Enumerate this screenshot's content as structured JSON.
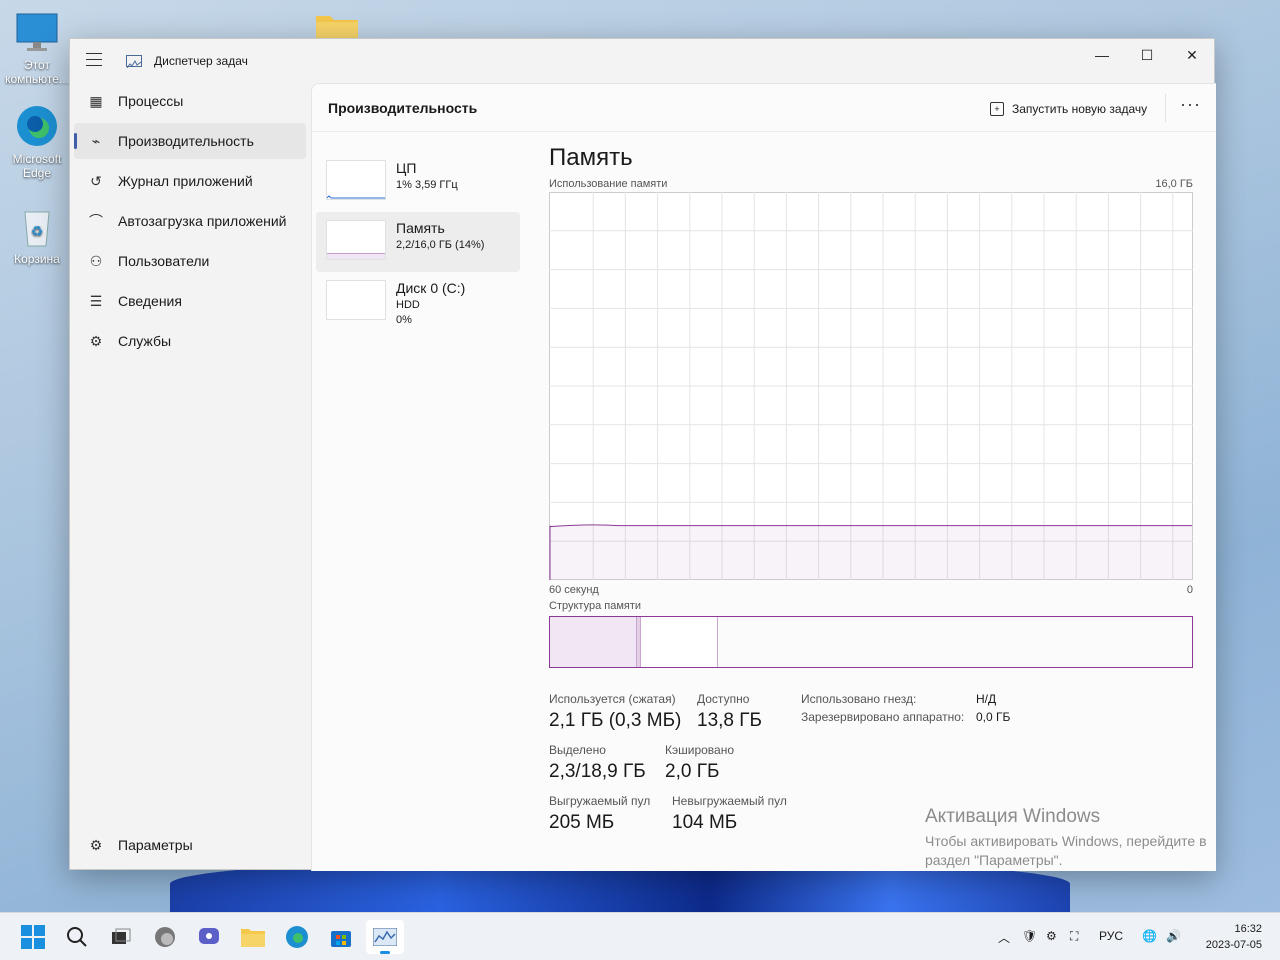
{
  "desktop": {
    "icons": [
      {
        "label": "Этот компьюте..."
      },
      {
        "label": "Microsoft Edge"
      },
      {
        "label": "Корзина"
      }
    ]
  },
  "window": {
    "title": "Диспетчер задач",
    "controls": {
      "minimize": "—",
      "maximize": "☐",
      "close": "✕"
    }
  },
  "nav": {
    "items": [
      {
        "label": "Процессы",
        "icon": "processes-icon"
      },
      {
        "label": "Производительность",
        "icon": "performance-icon",
        "active": true
      },
      {
        "label": "Журнал приложений",
        "icon": "history-icon"
      },
      {
        "label": "Автозагрузка приложений",
        "icon": "startup-icon"
      },
      {
        "label": "Пользователи",
        "icon": "users-icon"
      },
      {
        "label": "Сведения",
        "icon": "details-icon"
      },
      {
        "label": "Службы",
        "icon": "services-icon"
      }
    ],
    "settings_label": "Параметры"
  },
  "header": {
    "title": "Производительность",
    "run_task": "Запустить новую задачу",
    "more": "···"
  },
  "perf_list": [
    {
      "name": "ЦП",
      "sub1": "1% 3,59 ГГц",
      "sub2": ""
    },
    {
      "name": "Память",
      "sub1": "2,2/16,0 ГБ (14%)",
      "sub2": "",
      "selected": true
    },
    {
      "name": "Диск 0 (C:)",
      "sub1": "HDD",
      "sub2": "0%"
    }
  ],
  "memory": {
    "title": "Память",
    "usage_label": "Использование памяти",
    "max_label": "16,0 ГБ",
    "time_left": "60 секунд",
    "time_right": "0",
    "usage_fraction": 0.14,
    "structure_label": "Структура памяти",
    "structure_in_use_fraction": 0.135,
    "structure_modified_fraction": 0.006,
    "structure_standby_fraction": 0.12,
    "stats": {
      "in_use_label": "Используется (сжатая)",
      "in_use_value": "2,1 ГБ (0,3 МБ)",
      "available_label": "Доступно",
      "available_value": "13,8 ГБ",
      "committed_label": "Выделено",
      "committed_value": "2,3/18,9 ГБ",
      "cached_label": "Кэшировано",
      "cached_value": "2,0 ГБ",
      "paged_label": "Выгружаемый пул",
      "paged_value": "205 МБ",
      "nonpaged_label": "Невыгружаемый пул",
      "nonpaged_value": "104 МБ",
      "slots_label": "Использовано гнезд:",
      "slots_value": "Н/Д",
      "reserved_label": "Зарезервировано аппаратно:",
      "reserved_value": "0,0 ГБ"
    }
  },
  "activation": {
    "title": "Активация Windows",
    "text": "Чтобы активировать Windows, перейдите в раздел \"Параметры\"."
  },
  "taskbar": {
    "lang": "РУС",
    "time": "16:32",
    "date": "2023-07-05"
  },
  "colors": {
    "accent": "#8b3a96",
    "nav_indicator": "#3f5fa8"
  }
}
